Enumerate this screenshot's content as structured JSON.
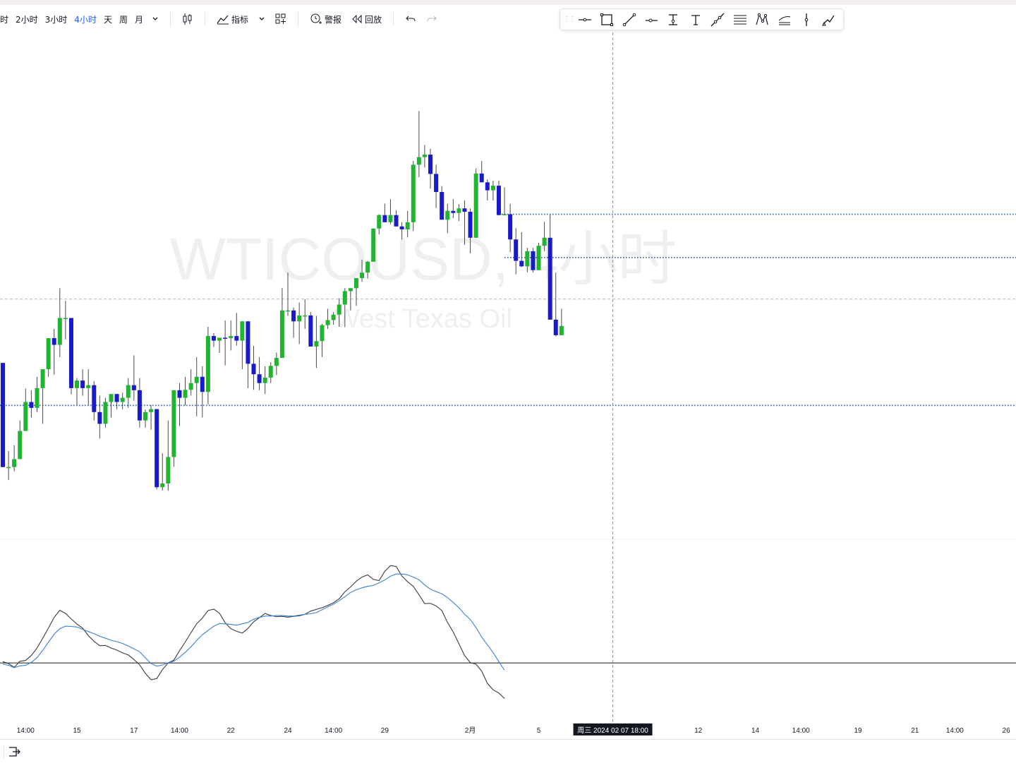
{
  "toolbar": {
    "timeframes": [
      "时",
      "2小时",
      "3小时",
      "4小时",
      "天",
      "周",
      "月"
    ],
    "active_timeframe": "4小时",
    "indicators_label": "指标",
    "alert_label": "警报",
    "replay_label": "回放",
    "icons": [
      "chevron-down-icon",
      "candles-icon",
      "indicators-icon",
      "templates-icon",
      "alert-icon",
      "replay-icon",
      "undo-icon",
      "redo-icon"
    ]
  },
  "drawing_toolbar": {
    "tools": [
      "horizontal-line-icon",
      "rectangle-icon",
      "trend-line-icon",
      "horizontal-ray-icon",
      "price-range-icon",
      "text-icon",
      "extended-line-icon",
      "parallel-channel-icon",
      "xabcd-pattern-icon",
      "fib-retracement-icon",
      "vertical-line-icon",
      "brush-icon"
    ]
  },
  "chart_data": [
    {
      "type": "candlestick",
      "watermark": "WTICOUSD, 4小时",
      "watermark_sub": "West Texas Oil",
      "colors": {
        "up": "#21b430",
        "down": "#1a1acd",
        "wick": "#4a4a4a",
        "hline": "#2a5bd7",
        "crosshair": "#8a8f99"
      },
      "ylim": [
        0,
        100
      ],
      "crosshair_x_index": 107,
      "crosshair_label": "周三 2024 02 07   18:00",
      "x_labels": [
        {
          "i": 4,
          "label": "14:00"
        },
        {
          "i": 13,
          "label": "15"
        },
        {
          "i": 23,
          "label": "17"
        },
        {
          "i": 31,
          "label": "14:00"
        },
        {
          "i": 40,
          "label": "22"
        },
        {
          "i": 50,
          "label": "24"
        },
        {
          "i": 58,
          "label": "14:00"
        },
        {
          "i": 67,
          "label": "29"
        },
        {
          "i": 82,
          "label": "2月"
        },
        {
          "i": 94,
          "label": "5"
        },
        {
          "i": 122,
          "label": "12"
        },
        {
          "i": 132,
          "label": "14"
        },
        {
          "i": 140,
          "label": "14:00"
        },
        {
          "i": 150,
          "label": "19"
        },
        {
          "i": 160,
          "label": "21"
        },
        {
          "i": 167,
          "label": "14:00"
        },
        {
          "i": 176,
          "label": "26"
        }
      ],
      "horizontal_levels": [
        {
          "value": 66.8,
          "start_index": 87,
          "style": "dotted"
        },
        {
          "value": 56.5,
          "start_index": 88,
          "style": "dotted"
        },
        {
          "value": 46.6,
          "start_index": 0,
          "style": "dashed-light"
        },
        {
          "value": 21.3,
          "start_index": 0,
          "style": "dotted"
        }
      ],
      "candles": [
        [
          31.4,
          31.4,
          6.6,
          6.6
        ],
        [
          6.6,
          10.4,
          3.5,
          6.6
        ],
        [
          6.6,
          11.8,
          5.6,
          8.5
        ],
        [
          8.5,
          17.7,
          8.5,
          15.2
        ],
        [
          15.2,
          25.3,
          15.2,
          22.1
        ],
        [
          22.1,
          24.9,
          18.4,
          20.7
        ],
        [
          20.7,
          28.1,
          19.7,
          25.4
        ],
        [
          25.4,
          28.8,
          16.9,
          29.9
        ],
        [
          29.9,
          33.2,
          28.1,
          37.3
        ],
        [
          37.3,
          39.5,
          28.6,
          35.7
        ],
        [
          35.7,
          49.2,
          32.8,
          42.1
        ],
        [
          42.1,
          46.2,
          37.0,
          42.1
        ],
        [
          42.1,
          42.1,
          23.9,
          25.4
        ],
        [
          25.4,
          27.8,
          21.3,
          27.2
        ],
        [
          27.2,
          29.9,
          23.6,
          25.4
        ],
        [
          25.4,
          29.9,
          21.3,
          26.1
        ],
        [
          26.1,
          27.1,
          17.7,
          19.7
        ],
        [
          19.7,
          23.6,
          13.4,
          16.9
        ],
        [
          16.9,
          23.1,
          16.0,
          22.1
        ],
        [
          22.1,
          23.6,
          18.4,
          24.0
        ],
        [
          24.0,
          23.1,
          20.3,
          22.1
        ],
        [
          22.1,
          24.3,
          20.3,
          23.1
        ],
        [
          23.1,
          27.8,
          20.7,
          26.1
        ],
        [
          26.1,
          33.2,
          22.4,
          24.9
        ],
        [
          24.9,
          27.8,
          16.0,
          17.7
        ],
        [
          17.7,
          20.3,
          16.0,
          19.7
        ],
        [
          19.7,
          21.3,
          15.5,
          20.4
        ],
        [
          20.4,
          20.4,
          1.3,
          1.8
        ],
        [
          1.8,
          9.9,
          1.0,
          2.7
        ],
        [
          2.7,
          17.7,
          1.0,
          9.0
        ],
        [
          9.0,
          24.3,
          6.7,
          24.9
        ],
        [
          24.9,
          26.6,
          16.4,
          23.1
        ],
        [
          23.1,
          28.1,
          21.3,
          25.0
        ],
        [
          25.0,
          29.9,
          23.6,
          26.6
        ],
        [
          26.6,
          32.8,
          18.7,
          28.1
        ],
        [
          28.1,
          30.6,
          18.4,
          24.5
        ],
        [
          24.5,
          40.0,
          21.5,
          37.8
        ],
        [
          37.8,
          38.5,
          35.2,
          36.7
        ],
        [
          36.7,
          37.4,
          33.8,
          37.4
        ],
        [
          37.4,
          41.5,
          30.8,
          37.3
        ],
        [
          37.3,
          41.5,
          34.4,
          37.8
        ],
        [
          37.8,
          43.3,
          35.5,
          36.7
        ],
        [
          36.7,
          38.5,
          29.9,
          41.3
        ],
        [
          41.3,
          40.4,
          25.4,
          31.2
        ],
        [
          31.2,
          35.5,
          25.0,
          28.7
        ],
        [
          28.7,
          32.8,
          24.9,
          26.6
        ],
        [
          26.6,
          30.6,
          24.0,
          27.9
        ],
        [
          27.9,
          31.6,
          26.6,
          30.7
        ],
        [
          30.7,
          33.9,
          28.5,
          32.6
        ],
        [
          32.6,
          49.2,
          32.6,
          43.9
        ],
        [
          43.9,
          52.9,
          42.6,
          43.9
        ],
        [
          43.9,
          44.6,
          37.4,
          41.3
        ],
        [
          41.3,
          45.8,
          35.9,
          42.7
        ],
        [
          42.7,
          46.6,
          39.5,
          42.7
        ],
        [
          42.7,
          43.5,
          35.9,
          35.3
        ],
        [
          35.3,
          42.6,
          30.2,
          36.6
        ],
        [
          36.6,
          40.7,
          32.8,
          40.4
        ],
        [
          40.4,
          44.3,
          39.5,
          41.6
        ],
        [
          41.6,
          43.5,
          40.5,
          42.9
        ],
        [
          42.9,
          46.8,
          40.0,
          45.3
        ],
        [
          45.3,
          49.2,
          39.9,
          48.5
        ],
        [
          48.5,
          49.0,
          43.9,
          49.2
        ],
        [
          49.2,
          51.2,
          45.0,
          51.6
        ],
        [
          51.6,
          56.0,
          50.7,
          52.9
        ],
        [
          52.9,
          55.7,
          51.5,
          55.5
        ],
        [
          55.5,
          63.4,
          55.7,
          63.4
        ],
        [
          63.4,
          66.8,
          62.0,
          66.6
        ],
        [
          66.6,
          69.3,
          64.9,
          64.9
        ],
        [
          64.9,
          70.4,
          64.4,
          66.6
        ],
        [
          66.6,
          67.8,
          64.2,
          63.9
        ],
        [
          63.9,
          64.9,
          60.8,
          63.2
        ],
        [
          63.2,
          67.6,
          61.3,
          64.9
        ],
        [
          64.9,
          79.5,
          62.8,
          78.6
        ],
        [
          78.6,
          91.4,
          75.6,
          80.4
        ],
        [
          80.4,
          83.3,
          77.9,
          81.0
        ],
        [
          81.0,
          82.4,
          72.9,
          76.4
        ],
        [
          76.4,
          78.6,
          68.3,
          72.1
        ],
        [
          72.1,
          73.5,
          65.5,
          65.5
        ],
        [
          65.5,
          69.3,
          62.3,
          67.6
        ],
        [
          67.6,
          70.4,
          65.9,
          67.1
        ],
        [
          67.1,
          69.2,
          65.2,
          68.2
        ],
        [
          68.2,
          70.1,
          59.5,
          67.4
        ],
        [
          67.4,
          68.2,
          57.5,
          61.2
        ],
        [
          61.2,
          77.7,
          61.2,
          76.5
        ],
        [
          76.5,
          79.5,
          74.6,
          74.4
        ],
        [
          74.4,
          75.1,
          70.1,
          72.5
        ],
        [
          72.5,
          74.8,
          70.1,
          73.6
        ],
        [
          73.6,
          74.8,
          66.8,
          66.6
        ],
        [
          66.6,
          73.2,
          66.6,
          66.8
        ],
        [
          66.8,
          69.3,
          57.8,
          60.8
        ],
        [
          60.8,
          63.5,
          52.5,
          55.7
        ],
        [
          55.7,
          62.5,
          54.2,
          54.4
        ],
        [
          54.4,
          58.8,
          53.0,
          58.0
        ],
        [
          58.0,
          58.8,
          52.9,
          53.5
        ],
        [
          53.5,
          60.0,
          53.5,
          59.3
        ],
        [
          59.3,
          65.0,
          58.0,
          61.2
        ],
        [
          61.2,
          66.8,
          58.0,
          41.7
        ],
        [
          41.7,
          52.9,
          37.7,
          38.0
        ],
        [
          38.0,
          44.3,
          38.0,
          40.2
        ]
      ]
    },
    {
      "type": "line",
      "ylim": [
        -20,
        40
      ],
      "zero_line": 0,
      "series": [
        {
          "color": "#3a3a3a",
          "values": [
            0.5,
            -0.2,
            -1.5,
            0.6,
            0.9,
            2.6,
            5.2,
            8.6,
            12.1,
            15.8,
            18.3,
            17.2,
            15.3,
            13.5,
            12.1,
            9.5,
            7.5,
            6.0,
            6.1,
            5.2,
            4.5,
            3.5,
            2.8,
            1.2,
            -0.6,
            -3.6,
            -5.8,
            -5.4,
            -2.3,
            0.0,
            1.0,
            4.3,
            7.3,
            10.5,
            13.6,
            15.6,
            18.2,
            18.7,
            17.3,
            14.0,
            11.9,
            11.0,
            10.4,
            12.0,
            14.3,
            15.7,
            17.2,
            16.5,
            16.1,
            16.2,
            15.9,
            16.2,
            16.4,
            16.9,
            18.0,
            18.6,
            19.2,
            20.0,
            20.9,
            22.3,
            24.7,
            26.4,
            28.4,
            29.8,
            30.6,
            29.0,
            28.6,
            31.8,
            33.8,
            33.5,
            30.2,
            28.2,
            26.6,
            23.7,
            20.6,
            20.7,
            19.8,
            18.2,
            14.1,
            10.8,
            6.7,
            2.6,
            0.1,
            -0.4,
            -2.8,
            -7.1,
            -9.3,
            -10.4,
            -12.3
          ]
        },
        {
          "color": "#3b7fd4",
          "values": [
            -0.4,
            -0.8,
            -1.6,
            -1.0,
            -0.8,
            0.2,
            1.9,
            4.4,
            7.2,
            10.0,
            11.9,
            12.8,
            12.7,
            12.5,
            11.7,
            10.9,
            10.2,
            9.3,
            8.6,
            7.9,
            7.4,
            6.8,
            5.9,
            4.9,
            3.9,
            1.8,
            -0.2,
            -1.1,
            -0.7,
            0.1,
            0.6,
            2.0,
            3.7,
            5.6,
            7.8,
            9.8,
            11.3,
            12.8,
            13.7,
            13.6,
            13.4,
            13.1,
            13.6,
            14.1,
            15.2,
            15.8,
            16.3,
            16.3,
            16.5,
            16.5,
            16.3,
            16.3,
            16.6,
            16.9,
            17.1,
            17.5,
            18.5,
            19.5,
            20.4,
            21.6,
            23.0,
            24.5,
            25.4,
            26.1,
            26.6,
            26.9,
            27.8,
            28.8,
            30.1,
            30.9,
            30.9,
            30.6,
            29.8,
            28.9,
            27.1,
            25.6,
            24.8,
            24.0,
            22.7,
            21.0,
            19.2,
            16.9,
            15.1,
            12.3,
            9.0,
            6.3,
            3.6,
            0.5,
            -2.5
          ]
        }
      ]
    }
  ]
}
